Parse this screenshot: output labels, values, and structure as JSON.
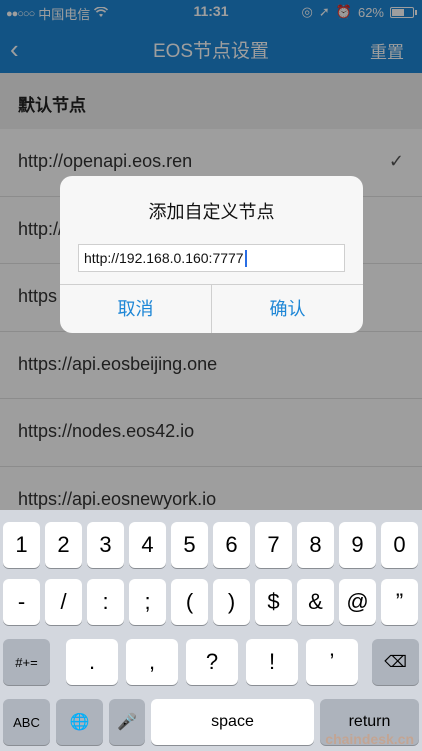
{
  "status_bar": {
    "signal": "●●○○○",
    "carrier": "中国电信",
    "wifi_icon": "wifi-icon",
    "time": "11:31",
    "battery_percent": "62%",
    "battery_level": 0.62
  },
  "nav": {
    "back": "‹",
    "title": "EOS节点设置",
    "reset": "重置"
  },
  "section": {
    "title": "默认节点"
  },
  "nodes": [
    {
      "url": "http://openapi.eos.ren",
      "check": "✓"
    },
    {
      "url": "http://"
    },
    {
      "url": "https"
    },
    {
      "url": "https://api.eosbeijing.one"
    },
    {
      "url": "https://nodes.eos42.io"
    },
    {
      "url": "https://api.eosnewyork.io"
    }
  ],
  "dialog": {
    "title": "添加自定义节点",
    "input_value": "http://192.168.0.160:7777",
    "cancel": "取消",
    "confirm": "确认"
  },
  "keyboard": {
    "row1": [
      "1",
      "2",
      "3",
      "4",
      "5",
      "6",
      "7",
      "8",
      "9",
      "0"
    ],
    "row2": [
      "-",
      "/",
      ":",
      ";",
      "(",
      ")",
      "$",
      "&",
      "@",
      "”"
    ],
    "row3": {
      "shift": "#+=",
      "keys": [
        ".",
        ",",
        "?",
        "!",
        "’"
      ],
      "backspace": "⌫"
    },
    "row4": {
      "abc": "ABC",
      "globe": "🌐",
      "mic": "🎤",
      "space": "space",
      "return": "return"
    }
  },
  "watermark": "chaindesk.cn"
}
